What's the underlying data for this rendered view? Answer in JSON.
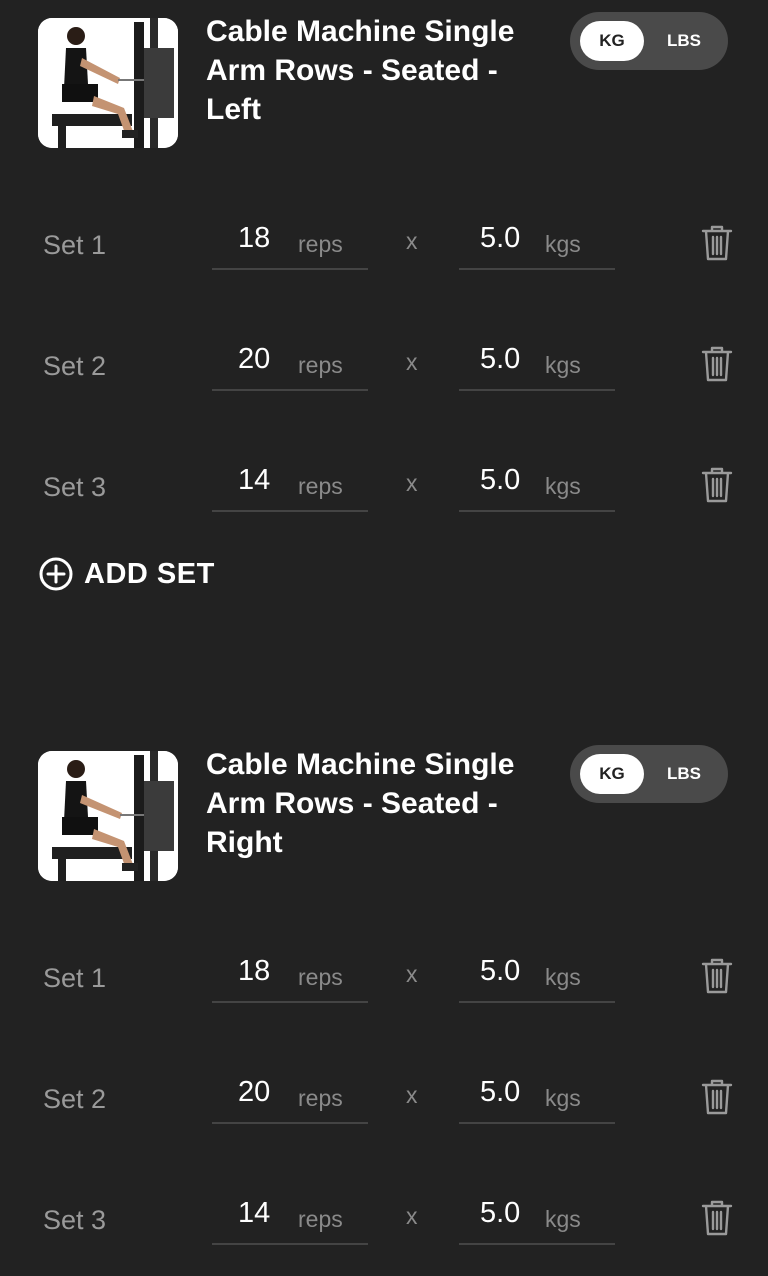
{
  "exercises": [
    {
      "title": "Cable Machine Single Arm Rows - Seated - Left",
      "unit_toggle": {
        "kg_label": "KG",
        "lbs_label": "LBS",
        "selected": "KG"
      },
      "sets": [
        {
          "label": "Set 1",
          "reps": "18",
          "reps_unit": "reps",
          "times": "x",
          "weight": "5.0",
          "weight_unit": "kgs"
        },
        {
          "label": "Set 2",
          "reps": "20",
          "reps_unit": "reps",
          "times": "x",
          "weight": "5.0",
          "weight_unit": "kgs"
        },
        {
          "label": "Set 3",
          "reps": "14",
          "reps_unit": "reps",
          "times": "x",
          "weight": "5.0",
          "weight_unit": "kgs"
        }
      ],
      "add_set_label": "ADD SET",
      "image_icon": "exercise-thumbnail"
    },
    {
      "title": "Cable Machine Single Arm Rows - Seated - Right",
      "unit_toggle": {
        "kg_label": "KG",
        "lbs_label": "LBS",
        "selected": "KG"
      },
      "sets": [
        {
          "label": "Set 1",
          "reps": "18",
          "reps_unit": "reps",
          "times": "x",
          "weight": "5.0",
          "weight_unit": "kgs"
        },
        {
          "label": "Set 2",
          "reps": "20",
          "reps_unit": "reps",
          "times": "x",
          "weight": "5.0",
          "weight_unit": "kgs"
        },
        {
          "label": "Set 3",
          "reps": "14",
          "reps_unit": "reps",
          "times": "x",
          "weight": "5.0",
          "weight_unit": "kgs"
        }
      ],
      "image_icon": "exercise-thumbnail"
    }
  ],
  "colors": {
    "background": "#222222",
    "toggle_track": "#4a4a4a",
    "toggle_active": "#ffffff",
    "muted_text": "#9a9a9a",
    "underline": "#444444"
  },
  "icons": {
    "delete": "trash-icon",
    "add": "plus-circle-icon"
  }
}
